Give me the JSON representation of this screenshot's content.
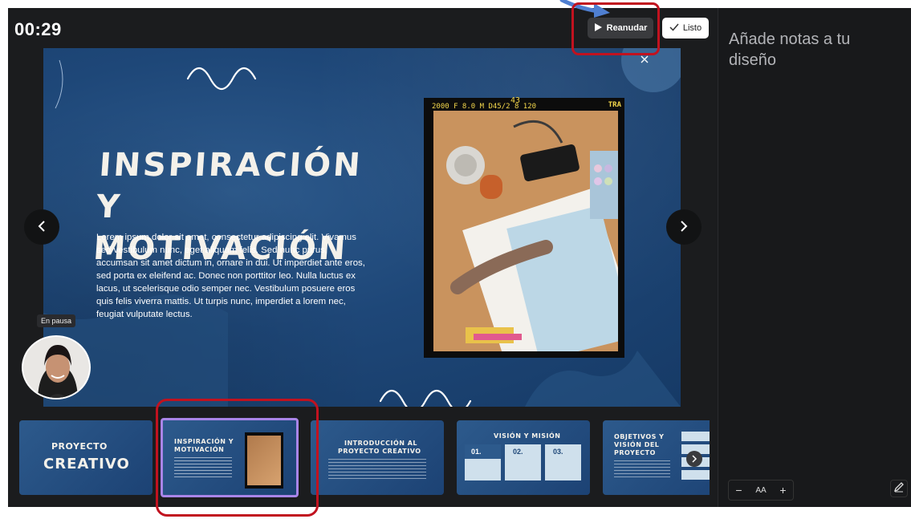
{
  "presenter": {
    "timer": "00:29",
    "resume_label": "Reanudar",
    "done_label": "Listo",
    "pause_badge": "En pausa"
  },
  "slide": {
    "title_line1": "Inspiración y",
    "title_line2": "motivación",
    "body": "Lorem ipsum dolor sit amet, consectetur adipiscing elit. Vivamus sed vestibulum nunc, eget aliquam felis. Sed nunc purus, accumsan sit amet dictum in, ornare in dui. Ut imperdiet ante eros, sed porta ex eleifend ac. Donec non porttitor leo. Nulla luctus ex lacus, ut scelerisque odio semper nec. Vestibulum posuere eros quis felis viverra mattis. Ut turpis nunc, imperdiet a lorem nec, feugiat vulputate lectus.",
    "photo_header_left": "2000 F 8.0   M   D45/2 8 120",
    "photo_header_num": "43",
    "photo_header_right": "TRA"
  },
  "thumbnails": [
    {
      "line1": "Proyecto",
      "line2": "Creativo"
    },
    {
      "line1": "Inspiración y",
      "line2": "motivación"
    },
    {
      "line1": "Introducción al",
      "line2": "proyecto creativo"
    },
    {
      "title": "Visión y misión",
      "c1": "01.",
      "c2": "02.",
      "c3": "03."
    },
    {
      "line1": "Objetivos y",
      "line2": "visión del",
      "line3": "proyecto"
    }
  ],
  "notes": {
    "placeholder": "Añade notas a tu diseño"
  },
  "zoom": {
    "minus": "−",
    "label": "AA",
    "plus": "+"
  },
  "colors": {
    "background": "#18191b",
    "slide_blue": "#1e4778",
    "selected_thumb_border": "#a985e8",
    "annotation_red": "#c1121f",
    "annotation_arrow": "#4f7fd1"
  }
}
